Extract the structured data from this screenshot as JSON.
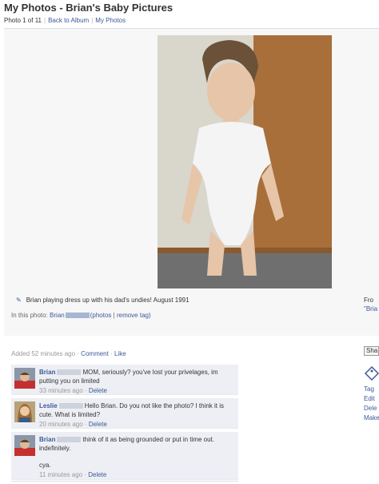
{
  "header": {
    "title": "My Photos - Brian's Baby Pictures",
    "photo_position": "Photo 1 of 11",
    "back_to_album": "Back to Album",
    "my_photos": "My Photos"
  },
  "photo": {
    "caption": "Brian playing dress up with his dad's undies! August 1991",
    "in_photo_label": "In this photo:",
    "tagged_name": "Brian",
    "photos_link": "(photos",
    "remove_tag": "remove tag)"
  },
  "sidebar_right": {
    "from_label": "Fro",
    "from_name": "\"Bria",
    "share": "Sha",
    "actions": [
      "Tag",
      "Edit",
      "Dele",
      "Make"
    ]
  },
  "activity": {
    "added": "Added 52 minutes ago",
    "comment": "Comment",
    "like": "Like"
  },
  "comments": [
    {
      "author": "Brian",
      "text": "MOM, seriously? you've lost your privelages, im putting you on limited",
      "time": "33 minutes ago",
      "delete": "Delete"
    },
    {
      "author": "Leslie",
      "text": "Hello Brian. Do you not like the photo? I think it is cute. What is limited?",
      "time": "20 minutes ago",
      "delete": "Delete"
    },
    {
      "author": "Brian",
      "text": "think of it as being grounded or put in time out. indefinitely.",
      "text2": "cya.",
      "time": "11 minutes ago",
      "delete": "Delete"
    }
  ],
  "colors": {
    "link": "#3b5998",
    "comment_bg": "#edeff4",
    "panel_bg": "#f7f7f7"
  }
}
